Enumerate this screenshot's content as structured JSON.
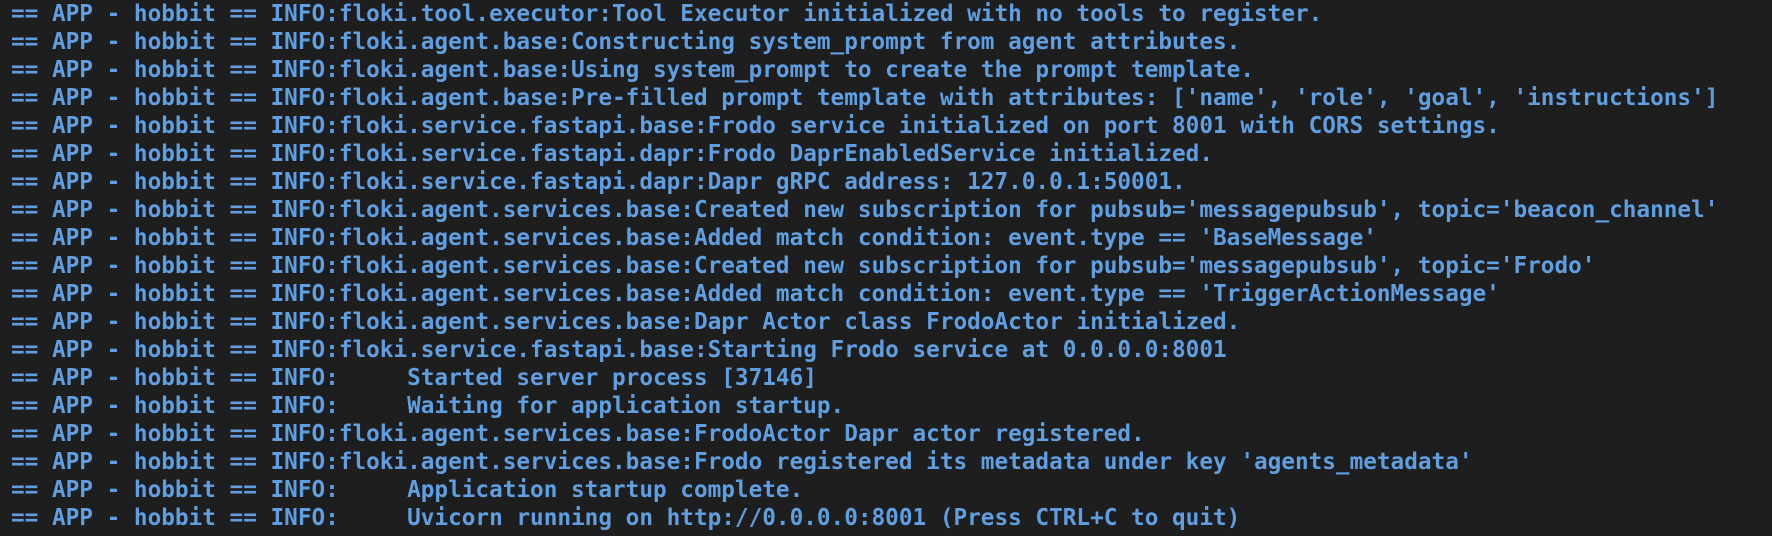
{
  "terminal": {
    "text_color": "#5f9ee0",
    "background_color": "#1e1e1e",
    "lines": [
      "== APP - hobbit == INFO:floki.tool.executor:Tool Executor initialized with no tools to register.",
      "== APP - hobbit == INFO:floki.agent.base:Constructing system_prompt from agent attributes.",
      "== APP - hobbit == INFO:floki.agent.base:Using system_prompt to create the prompt template.",
      "== APP - hobbit == INFO:floki.agent.base:Pre-filled prompt template with attributes: ['name', 'role', 'goal', 'instructions']",
      "== APP - hobbit == INFO:floki.service.fastapi.base:Frodo service initialized on port 8001 with CORS settings.",
      "== APP - hobbit == INFO:floki.service.fastapi.dapr:Frodo DaprEnabledService initialized.",
      "== APP - hobbit == INFO:floki.service.fastapi.dapr:Dapr gRPC address: 127.0.0.1:50001.",
      "== APP - hobbit == INFO:floki.agent.services.base:Created new subscription for pubsub='messagepubsub', topic='beacon_channel'",
      "== APP - hobbit == INFO:floki.agent.services.base:Added match condition: event.type == 'BaseMessage'",
      "== APP - hobbit == INFO:floki.agent.services.base:Created new subscription for pubsub='messagepubsub', topic='Frodo'",
      "== APP - hobbit == INFO:floki.agent.services.base:Added match condition: event.type == 'TriggerActionMessage'",
      "== APP - hobbit == INFO:floki.agent.services.base:Dapr Actor class FrodoActor initialized.",
      "== APP - hobbit == INFO:floki.service.fastapi.base:Starting Frodo service at 0.0.0.0:8001",
      "== APP - hobbit == INFO:     Started server process [37146]",
      "== APP - hobbit == INFO:     Waiting for application startup.",
      "== APP - hobbit == INFO:floki.agent.services.base:FrodoActor Dapr actor registered.",
      "== APP - hobbit == INFO:floki.agent.services.base:Frodo registered its metadata under key 'agents_metadata'",
      "== APP - hobbit == INFO:     Application startup complete.",
      "== APP - hobbit == INFO:     Uvicorn running on http://0.0.0.0:8001 (Press CTRL+C to quit)"
    ]
  }
}
